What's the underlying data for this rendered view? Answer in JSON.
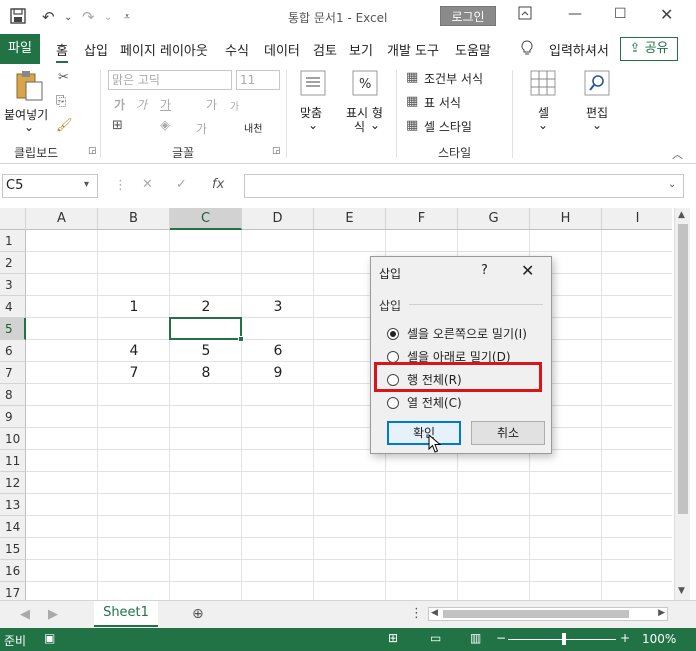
{
  "titlebar": {
    "title": "통합 문서1  -  Excel",
    "login_label": "로그인"
  },
  "tabs": [
    "파일",
    "홈",
    "삽입",
    "페이지 레이아웃",
    "수식",
    "데이터",
    "검토",
    "보기",
    "개발 도구",
    "도움말"
  ],
  "search_label": "입력하셔서",
  "share_label": "공유",
  "ribbon": {
    "paste_label": "붙여넣기",
    "paste_arrow": "⌄",
    "clipboard_group": "클립보드",
    "font_name": "맑은 고딕",
    "font_size": "11",
    "font_group": "글꼴",
    "align_label": "맞춤",
    "number_label_1": "표시 형",
    "number_label_2": "식",
    "conditional_label": "조건부 서식",
    "table_format_label": "표 서식",
    "cell_style_label": "셀 스타일",
    "style_group": "스타일",
    "cells_label": "셀",
    "edit_label": "편집",
    "font_btn_ga1": "가",
    "font_btn_ga2": "가",
    "font_btn_ga3": "가",
    "font_btn_ga4": "가",
    "font_btn_ga5": "가",
    "font_btn_ga6": "가",
    "font_btn_naejeok": "내천"
  },
  "formula_bar": {
    "name_box": "C5",
    "fx_symbol": "fx"
  },
  "grid": {
    "columns": [
      "A",
      "B",
      "C",
      "D",
      "E",
      "F",
      "G",
      "H",
      "I"
    ],
    "rows": [
      "1",
      "2",
      "3",
      "4",
      "5",
      "6",
      "7",
      "8",
      "9",
      "10",
      "11",
      "12",
      "13",
      "14",
      "15",
      "16",
      "17"
    ],
    "cells": {
      "B4": "1",
      "C4": "2",
      "D4": "3",
      "B6": "4",
      "C6": "5",
      "D6": "6",
      "B7": "7",
      "C7": "8",
      "D7": "9"
    }
  },
  "sheet_tab": "Sheet1",
  "statusbar": {
    "ready": "준비",
    "zoom": "100%"
  },
  "dialog": {
    "title": "삽입",
    "help": "?",
    "section": "삽입",
    "options": [
      "셀을 오른쪽으로 밀기(I)",
      "셀을 아래로 밀기(D)",
      "행 전체(R)",
      "열 전체(C)"
    ],
    "selected_index": 0,
    "ok_label": "확인",
    "cancel_label": "취소"
  },
  "colors": {
    "excel_green": "#217346",
    "highlight_red": "#d9141b"
  }
}
